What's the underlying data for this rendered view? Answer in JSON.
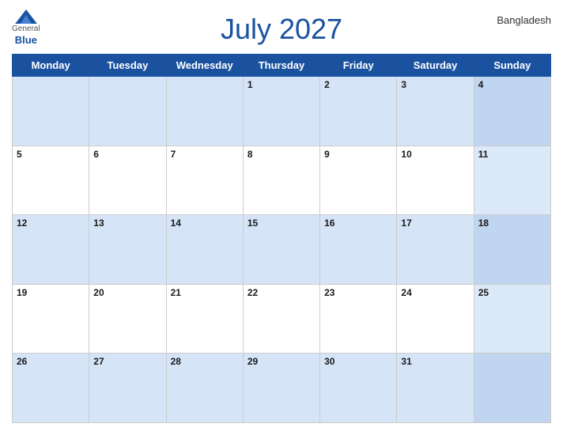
{
  "header": {
    "logo_general": "General",
    "logo_blue": "Blue",
    "month_title": "July 2027",
    "country": "Bangladesh"
  },
  "weekdays": [
    "Monday",
    "Tuesday",
    "Wednesday",
    "Thursday",
    "Friday",
    "Saturday",
    "Sunday"
  ],
  "weeks": [
    [
      {
        "day": "",
        "empty": true
      },
      {
        "day": "",
        "empty": true
      },
      {
        "day": "",
        "empty": true
      },
      {
        "day": "1",
        "empty": false
      },
      {
        "day": "2",
        "empty": false
      },
      {
        "day": "3",
        "empty": false
      },
      {
        "day": "4",
        "empty": false
      }
    ],
    [
      {
        "day": "5",
        "empty": false
      },
      {
        "day": "6",
        "empty": false
      },
      {
        "day": "7",
        "empty": false
      },
      {
        "day": "8",
        "empty": false
      },
      {
        "day": "9",
        "empty": false
      },
      {
        "day": "10",
        "empty": false
      },
      {
        "day": "11",
        "empty": false
      }
    ],
    [
      {
        "day": "12",
        "empty": false
      },
      {
        "day": "13",
        "empty": false
      },
      {
        "day": "14",
        "empty": false
      },
      {
        "day": "15",
        "empty": false
      },
      {
        "day": "16",
        "empty": false
      },
      {
        "day": "17",
        "empty": false
      },
      {
        "day": "18",
        "empty": false
      }
    ],
    [
      {
        "day": "19",
        "empty": false
      },
      {
        "day": "20",
        "empty": false
      },
      {
        "day": "21",
        "empty": false
      },
      {
        "day": "22",
        "empty": false
      },
      {
        "day": "23",
        "empty": false
      },
      {
        "day": "24",
        "empty": false
      },
      {
        "day": "25",
        "empty": false
      }
    ],
    [
      {
        "day": "26",
        "empty": false
      },
      {
        "day": "27",
        "empty": false
      },
      {
        "day": "28",
        "empty": false
      },
      {
        "day": "29",
        "empty": false
      },
      {
        "day": "30",
        "empty": false
      },
      {
        "day": "31",
        "empty": false
      },
      {
        "day": "",
        "empty": true
      }
    ]
  ],
  "colors": {
    "header_bg": "#1a52a0",
    "odd_row": "#d6e4f7",
    "even_row": "#ffffff",
    "sunday_odd": "#c0d5ef",
    "sunday_even": "#dce9f8"
  }
}
